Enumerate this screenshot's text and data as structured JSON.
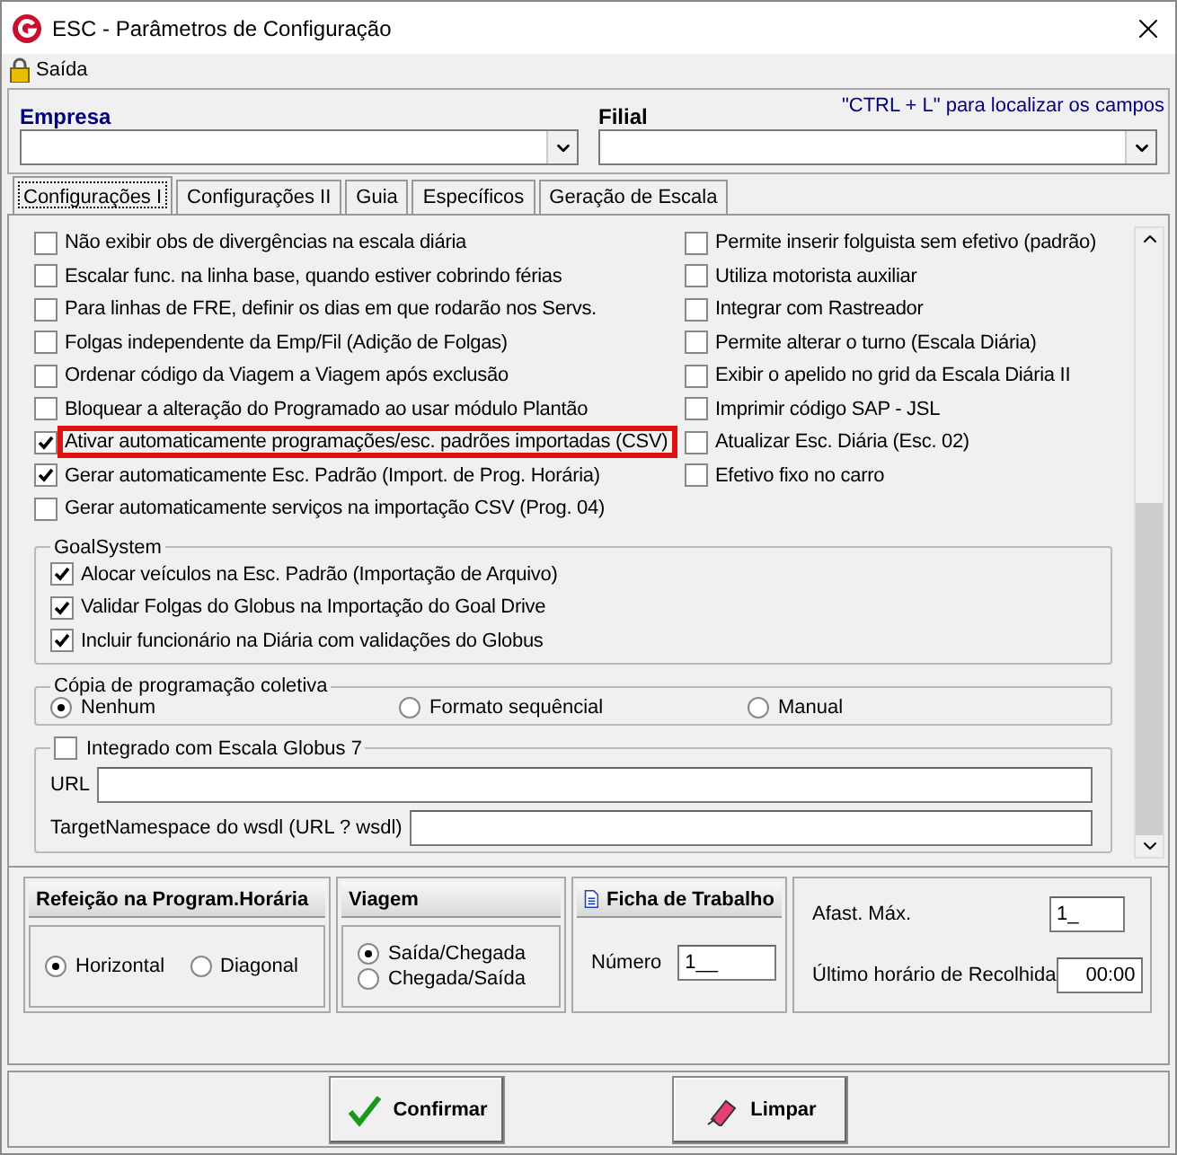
{
  "window": {
    "title": "ESC - Parâmetros de Configuração"
  },
  "menu": [
    {
      "label": "Saída"
    }
  ],
  "header": {
    "empresa_label": "Empresa",
    "filial_label": "Filial",
    "hint": "\"CTRL + L\" para localizar os campos"
  },
  "tabs": [
    {
      "label": "Configurações I",
      "selected": true
    },
    {
      "label": "Configurações II",
      "selected": false
    },
    {
      "label": "Guia",
      "selected": false
    },
    {
      "label": "Específicos",
      "selected": false
    },
    {
      "label": "Geração de Escala",
      "selected": false
    }
  ],
  "options_left": [
    {
      "label": "Não exibir obs de divergências na escala diária",
      "checked": false,
      "highlighted": false
    },
    {
      "label": "Escalar func. na linha base, quando estiver cobrindo férias",
      "checked": false,
      "highlighted": false
    },
    {
      "label": "Para linhas de FRE, definir os dias em que rodarão nos Servs.",
      "checked": false,
      "highlighted": false
    },
    {
      "label": "Folgas independente da Emp/Fil (Adição de Folgas)",
      "checked": false,
      "highlighted": false
    },
    {
      "label": "Ordenar código da Viagem a Viagem após exclusão",
      "checked": false,
      "highlighted": false
    },
    {
      "label": "Bloquear a alteração do Programado ao usar módulo Plantão",
      "checked": false,
      "highlighted": false
    },
    {
      "label": "Ativar automaticamente programações/esc. padrões importadas (CSV)",
      "checked": true,
      "highlighted": true
    },
    {
      "label": "Gerar automaticamente Esc. Padrão (Import. de Prog. Horária)",
      "checked": true,
      "highlighted": false
    },
    {
      "label": "Gerar automaticamente serviços na importação CSV (Prog. 04)",
      "checked": false,
      "highlighted": false
    }
  ],
  "options_right": [
    {
      "label": "Permite inserir folguista sem efetivo (padrão)",
      "checked": false
    },
    {
      "label": "Utiliza motorista auxiliar",
      "checked": false
    },
    {
      "label": "Integrar com Rastreador",
      "checked": false
    },
    {
      "label": "Permite alterar o turno (Escala Diária)",
      "checked": false
    },
    {
      "label": "Exibir o apelido no grid da Escala Diária II",
      "checked": false
    },
    {
      "label": "Imprimir código SAP - JSL",
      "checked": false
    },
    {
      "label": "Atualizar Esc. Diária (Esc. 02)",
      "checked": false
    },
    {
      "label": "Efetivo fixo no carro",
      "checked": false
    }
  ],
  "goal_system": {
    "title": "GoalSystem",
    "options": [
      {
        "label": "Alocar veículos na Esc. Padrão (Importação de Arquivo)",
        "checked": true
      },
      {
        "label": "Validar Folgas do Globus na Importação do Goal Drive",
        "checked": true
      },
      {
        "label": "Incluir funcionário na Diária com validações do Globus",
        "checked": true
      }
    ]
  },
  "copia": {
    "title": "Cópia de programação coletiva",
    "options": [
      {
        "label": "Nenhum",
        "selected": true
      },
      {
        "label": "Formato sequêncial",
        "selected": false
      },
      {
        "label": "Manual",
        "selected": false
      }
    ]
  },
  "globus": {
    "label": "Integrado com Escala Globus 7",
    "checked": false,
    "fields": [
      {
        "label": "URL"
      },
      {
        "label": "TargetNamespace do wsdl (URL ? wsdl)"
      }
    ]
  },
  "refeicao": {
    "title": "Refeição na Program.Horária",
    "options": [
      {
        "label": "Horizontal",
        "selected": true
      },
      {
        "label": "Diagonal",
        "selected": false
      }
    ]
  },
  "viagem": {
    "title": "Viagem",
    "options": [
      {
        "label": "Saída/Chegada",
        "selected": true
      },
      {
        "label": "Chegada/Saída",
        "selected": false
      }
    ]
  },
  "ficha": {
    "title": "Ficha de Trabalho",
    "field_label": "Número",
    "value": "1__"
  },
  "afastamento": {
    "fields": [
      {
        "label": "Afast. Máx.",
        "value": "1_",
        "kind": "short"
      },
      {
        "label": "Último horário de Recolhida",
        "value": "00:00",
        "kind": "time"
      }
    ]
  },
  "buttons": [
    {
      "label": "Confirmar",
      "kind": "confirm"
    },
    {
      "label": "Limpar",
      "kind": "clear"
    }
  ]
}
